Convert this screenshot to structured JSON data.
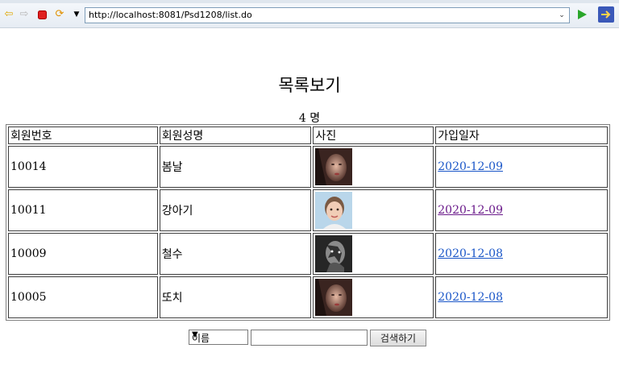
{
  "browser": {
    "url": "http://localhost:8081/Psd1208/list.do"
  },
  "page": {
    "title": "목록보기",
    "count_number": "4",
    "count_unit": "명"
  },
  "table": {
    "headers": [
      "회원번호",
      "회원성명",
      "사진",
      "가입일자"
    ],
    "rows": [
      {
        "id": "10014",
        "name": "봄날",
        "photo": "portrait-photo",
        "date": "2020-12-09",
        "visited": false
      },
      {
        "id": "10011",
        "name": "강아기",
        "photo": "child-photo",
        "date": "2020-12-09",
        "visited": true
      },
      {
        "id": "10009",
        "name": "철수",
        "photo": "monochrome-photo",
        "date": "2020-12-08",
        "visited": false
      },
      {
        "id": "10005",
        "name": "또치",
        "photo": "portrait-photo",
        "date": "2020-12-08",
        "visited": false
      }
    ]
  },
  "search": {
    "selected_option": "이름",
    "query": "",
    "button_label": "검색하기"
  },
  "colors": {
    "link": "#1a56c8",
    "visited_link": "#6a1a8a"
  }
}
